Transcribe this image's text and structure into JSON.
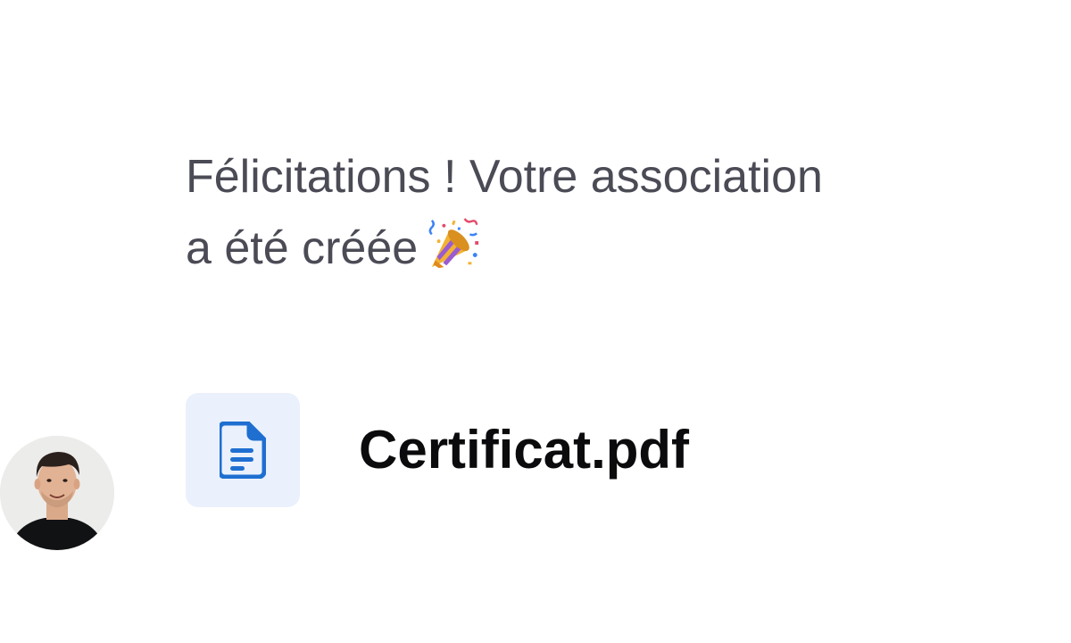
{
  "message": {
    "line1": "Félicitations ! Votre association",
    "line2": "a été créée",
    "emoji": "party-popper-icon"
  },
  "attachment": {
    "file_name": "Certificat.pdf",
    "icon": "document-icon",
    "icon_color": "#1f6fd1",
    "tile_color": "#eaf1fc"
  },
  "sender": {
    "avatar": "avatar"
  },
  "colors": {
    "message_text": "#4a4b55",
    "file_name_text": "#0b0b0d",
    "background": "#ffffff"
  }
}
